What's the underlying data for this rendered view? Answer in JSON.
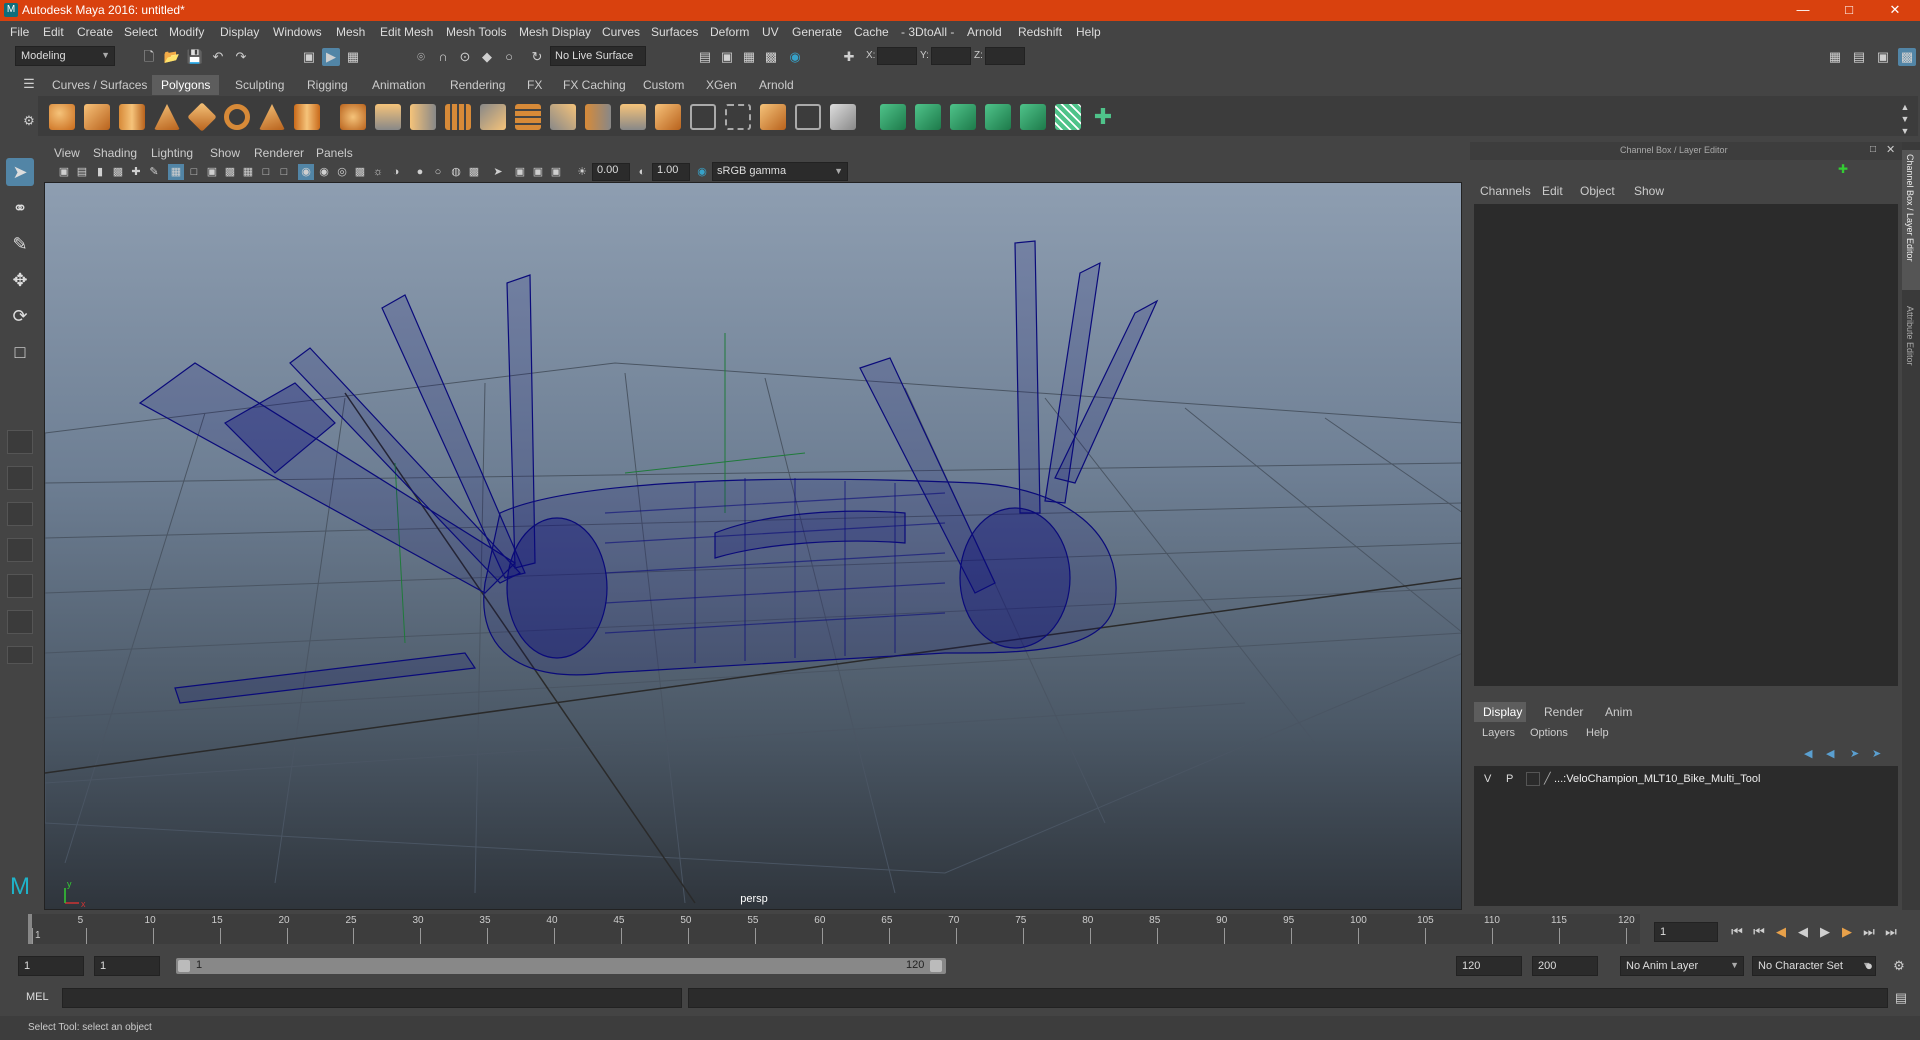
{
  "window": {
    "title": "Autodesk Maya 2016: untitled*",
    "app_icon": "maya-icon",
    "minimize": "—",
    "maximize": "□",
    "close": "✕"
  },
  "menubar": [
    "File",
    "Edit",
    "Create",
    "Select",
    "Modify",
    "Display",
    "Windows",
    "Mesh",
    "Edit Mesh",
    "Mesh Tools",
    "Mesh Display",
    "Curves",
    "Surfaces",
    "Deform",
    "UV",
    "Generate",
    "Cache",
    "- 3DtoAll -",
    "Arnold",
    "Redshift",
    "Help"
  ],
  "statusline": {
    "mode": "Modeling",
    "live_surface": "No Live Surface",
    "x_label": "X:",
    "y_label": "Y:",
    "z_label": "Z:"
  },
  "shelf_tabs": [
    "Curves / Surfaces",
    "Polygons",
    "Sculpting",
    "Rigging",
    "Animation",
    "Rendering",
    "FX",
    "FX Caching",
    "Custom",
    "XGen",
    "Arnold"
  ],
  "active_shelf_tab": "Polygons",
  "viewport": {
    "menu": [
      "View",
      "Shading",
      "Lighting",
      "Show",
      "Renderer",
      "Panels"
    ],
    "exposure": "0.00",
    "gamma": "1.00",
    "color_space": "sRGB gamma",
    "camera_label": "persp",
    "axis_x": "x",
    "axis_y": "y"
  },
  "channel_box": {
    "title": "Channel Box / Layer Editor",
    "menu": [
      "Channels",
      "Edit",
      "Object",
      "Show"
    ],
    "layer_tabs": [
      "Display",
      "Render",
      "Anim"
    ],
    "active_layer_tab": "Display",
    "layer_menu": [
      "Layers",
      "Options",
      "Help"
    ],
    "layer": {
      "v": "V",
      "p": "P",
      "name": "...:VeloChampion_MLT10_Bike_Multi_Tool"
    }
  },
  "side_tabs": [
    "Channel Box / Layer Editor",
    "Attribute Editor"
  ],
  "timeline": {
    "ticks": [
      "1",
      "5",
      "10",
      "15",
      "20",
      "25",
      "30",
      "35",
      "40",
      "45",
      "50",
      "55",
      "60",
      "65",
      "70",
      "75",
      "80",
      "85",
      "90",
      "95",
      "100",
      "105",
      "110",
      "115",
      "120"
    ],
    "current_frame": "1"
  },
  "range": {
    "start": "1",
    "playback_start": "1",
    "slider_start": "1",
    "slider_end": "120",
    "playback_end": "120",
    "end": "200",
    "anim_layer": "No Anim Layer",
    "char_set": "No Character Set"
  },
  "command": {
    "label": "MEL"
  },
  "help_line": "Select Tool: select an object",
  "colors": {
    "title_bar": "#d9410e",
    "accent": "#5285a6",
    "wireframe": "#0a0a7a"
  }
}
